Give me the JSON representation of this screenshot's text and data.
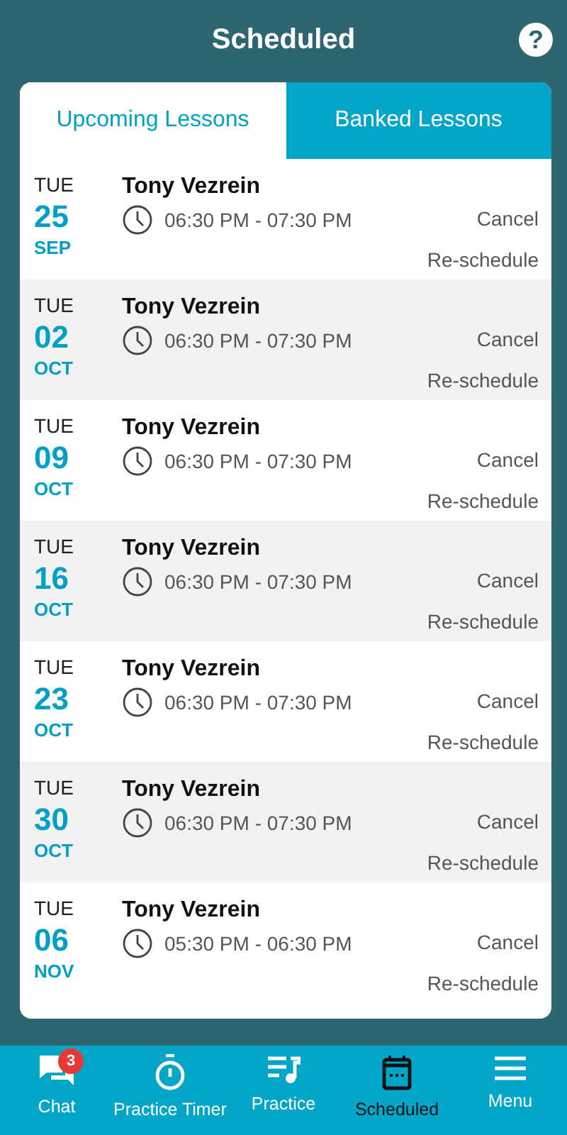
{
  "header": {
    "title": "Scheduled",
    "help_icon": "?"
  },
  "tabs": [
    {
      "label": "Upcoming Lessons",
      "selected": true
    },
    {
      "label": "Banked Lessons",
      "selected": false
    }
  ],
  "lessons": [
    {
      "weekday": "TUE",
      "day": "25",
      "month": "SEP",
      "teacher": "Tony Vezrein",
      "time": "06:30 PM - 07:30 PM",
      "cancel": "Cancel",
      "reschedule": "Re-schedule"
    },
    {
      "weekday": "TUE",
      "day": "02",
      "month": "OCT",
      "teacher": "Tony Vezrein",
      "time": "06:30 PM - 07:30 PM",
      "cancel": "Cancel",
      "reschedule": "Re-schedule"
    },
    {
      "weekday": "TUE",
      "day": "09",
      "month": "OCT",
      "teacher": "Tony Vezrein",
      "time": "06:30 PM - 07:30 PM",
      "cancel": "Cancel",
      "reschedule": "Re-schedule"
    },
    {
      "weekday": "TUE",
      "day": "16",
      "month": "OCT",
      "teacher": "Tony Vezrein",
      "time": "06:30 PM - 07:30 PM",
      "cancel": "Cancel",
      "reschedule": "Re-schedule"
    },
    {
      "weekday": "TUE",
      "day": "23",
      "month": "OCT",
      "teacher": "Tony Vezrein",
      "time": "06:30 PM - 07:30 PM",
      "cancel": "Cancel",
      "reschedule": "Re-schedule"
    },
    {
      "weekday": "TUE",
      "day": "30",
      "month": "OCT",
      "teacher": "Tony Vezrein",
      "time": "06:30 PM - 07:30 PM",
      "cancel": "Cancel",
      "reschedule": "Re-schedule"
    },
    {
      "weekday": "TUE",
      "day": "06",
      "month": "NOV",
      "teacher": "Tony Vezrein",
      "time": "05:30 PM - 06:30 PM",
      "cancel": "Cancel",
      "reschedule": "Re-schedule"
    }
  ],
  "bottom_nav": [
    {
      "kind": "chat",
      "label": "Chat",
      "badge": "3",
      "selected": false
    },
    {
      "kind": "timer",
      "label": "Practice Timer",
      "selected": false
    },
    {
      "kind": "practice",
      "label": "Practice",
      "selected": false
    },
    {
      "kind": "calendar",
      "label": "Scheduled",
      "selected": true
    },
    {
      "kind": "menu",
      "label": "Menu",
      "selected": false
    }
  ]
}
